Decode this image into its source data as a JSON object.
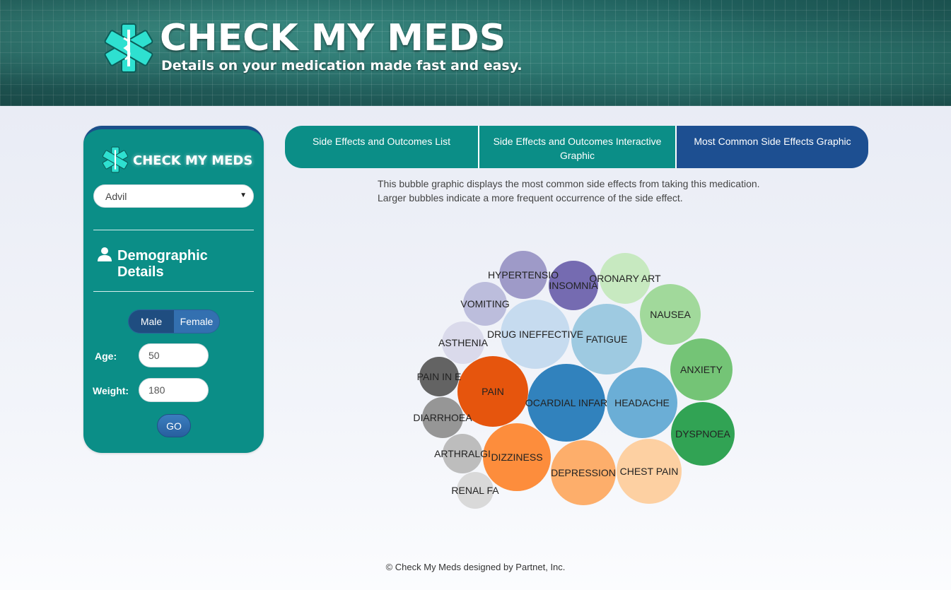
{
  "header": {
    "title": "CHECK MY MEDS",
    "tagline": "Details on your medication made fast and easy."
  },
  "sidebar": {
    "brand": "CHECK MY MEDS",
    "medication_selected": "Advil",
    "demographic_title": "Demographic Details",
    "gender": {
      "male_label": "Male",
      "female_label": "Female",
      "selected": "Male"
    },
    "age_label": "Age:",
    "age_value": "50",
    "weight_label": "Weight:",
    "weight_value": "180",
    "go_label": "GO"
  },
  "tabs": [
    {
      "label": "Side Effects and Outcomes List",
      "active": false
    },
    {
      "label": "Side Effects and Outcomes Interactive Graphic",
      "active": false
    },
    {
      "label": "Most Common Side Effects Graphic",
      "active": true
    }
  ],
  "description": {
    "line1": "This bubble graphic displays the most common side effects from taking this medication.",
    "line2": "Larger bubbles indicate a more frequent occurrence of the side effect."
  },
  "chart_data": {
    "type": "bubble",
    "bubbles": [
      {
        "label": "OCARDIAL INFAR",
        "size": 55,
        "color": "#3182bd"
      },
      {
        "label": "DRUG INEFFECTIVE",
        "size": 49,
        "color": "#c6dbef"
      },
      {
        "label": "PAIN",
        "size": 50,
        "color": "#e6550d"
      },
      {
        "label": "HEADACHE",
        "size": 50,
        "color": "#6baed6"
      },
      {
        "label": "FATIGUE",
        "size": 50,
        "color": "#9ecae1"
      },
      {
        "label": "DEPRESSION",
        "size": 46,
        "color": "#fdae6b"
      },
      {
        "label": "CHEST PAIN",
        "size": 46,
        "color": "#fdd0a2"
      },
      {
        "label": "DIZZINESS",
        "size": 48,
        "color": "#fd8d3c"
      },
      {
        "label": "DYSPNOEA",
        "size": 45,
        "color": "#31a354"
      },
      {
        "label": "ANXIETY",
        "size": 44,
        "color": "#74c476"
      },
      {
        "label": "NAUSEA",
        "size": 43,
        "color": "#a1d99b"
      },
      {
        "label": "ORONARY ART",
        "size": 36,
        "color": "#c7e9c0"
      },
      {
        "label": "INSOMNIA",
        "size": 35,
        "color": "#756bb1"
      },
      {
        "label": "HYPERTENSIO",
        "size": 34,
        "color": "#9e9ac8"
      },
      {
        "label": "VOMITING",
        "size": 31,
        "color": "#bcbddc"
      },
      {
        "label": "ASTHENIA",
        "size": 30,
        "color": "#dadaeb"
      },
      {
        "label": "PAIN IN E",
        "size": 28,
        "color": "#636363"
      },
      {
        "label": "DIARRHOEA",
        "size": 29,
        "color": "#969696"
      },
      {
        "label": "ARTHRALGI",
        "size": 28,
        "color": "#bdbdbd"
      },
      {
        "label": "RENAL FA",
        "size": 26,
        "color": "#d9d9d9"
      }
    ]
  },
  "footer": "© Check My Meds designed by Partnet, Inc."
}
